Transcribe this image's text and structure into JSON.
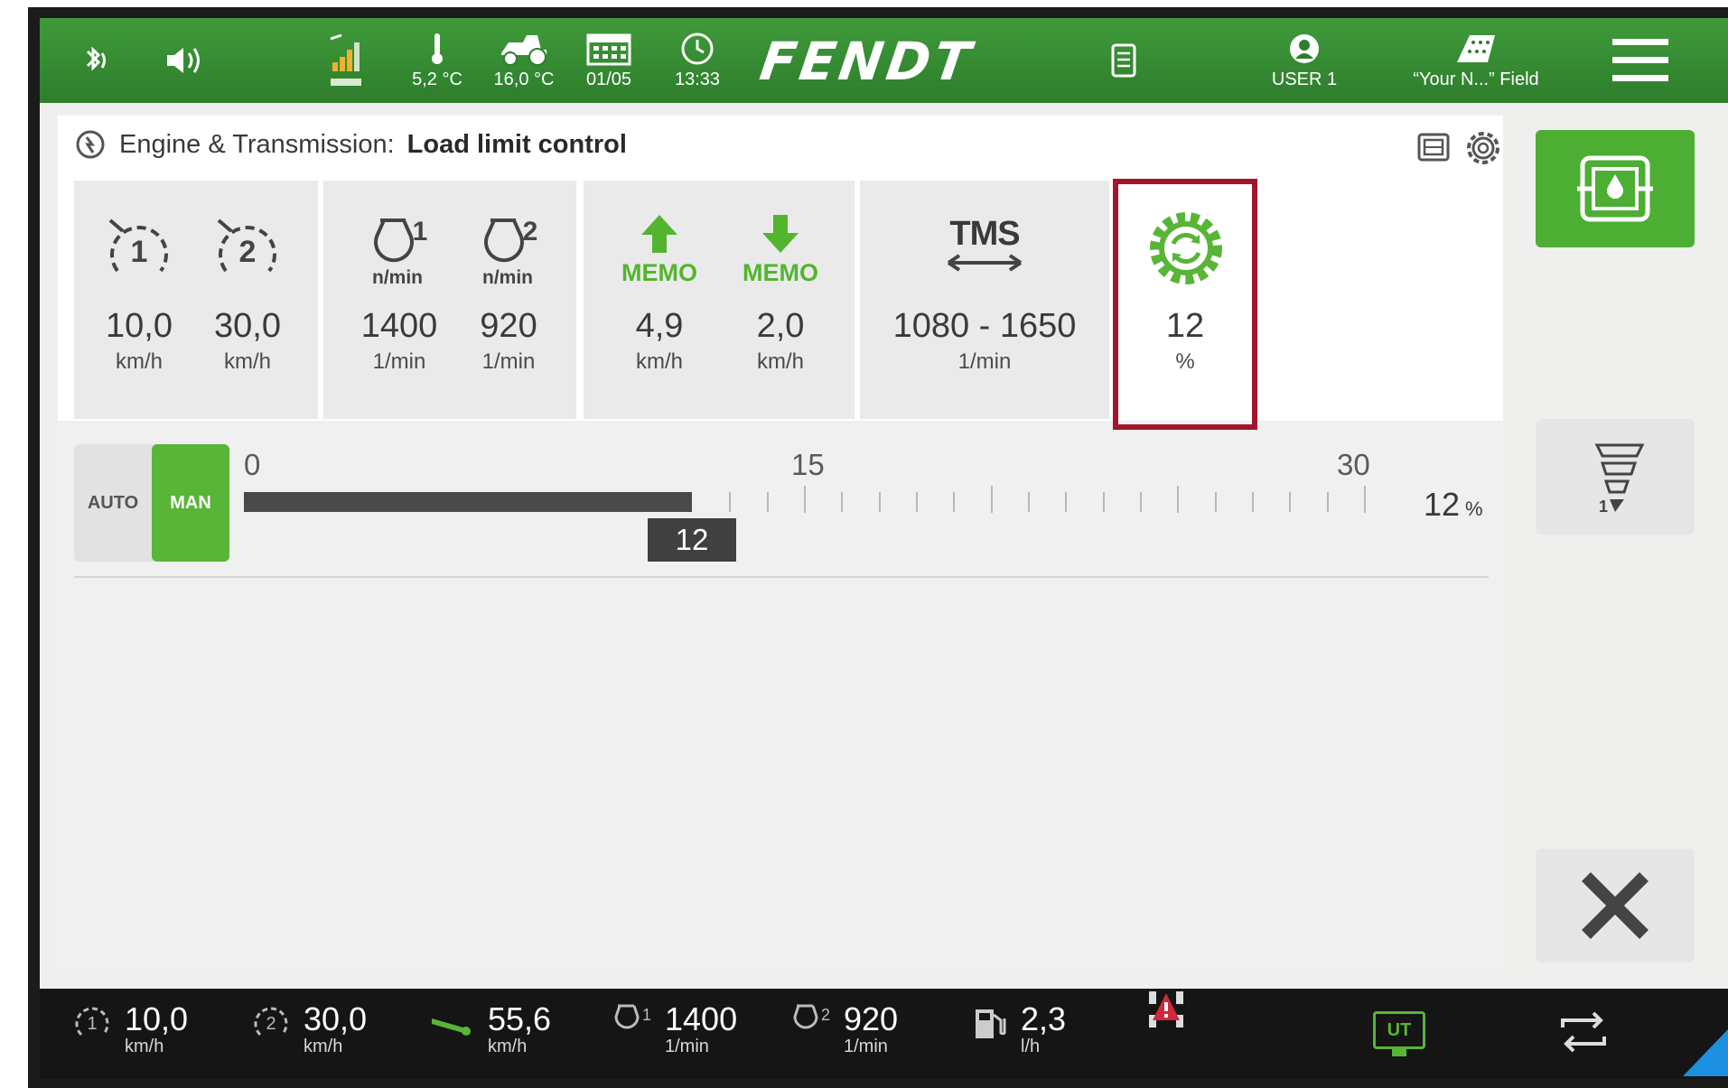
{
  "topbar": {
    "outside_temp": "5,2 °C",
    "engine_temp": "16,0 °C",
    "date": "01/05",
    "time": "13:33",
    "brand": "FENDT",
    "user": "USER 1",
    "field": "“Your N...” Field"
  },
  "header": {
    "prefix": "Engine & Transmission:",
    "title": "Load limit control"
  },
  "tiles": {
    "cruise1": {
      "value": "10,0",
      "unit": "km/h"
    },
    "cruise2": {
      "value": "30,0",
      "unit": "km/h"
    },
    "engine1": {
      "sub": "n/min",
      "value": "1400",
      "unit": "1/min",
      "index": "1"
    },
    "engine2": {
      "sub": "n/min",
      "value": "920",
      "unit": "1/min",
      "index": "2"
    },
    "memo_up": {
      "label": "MEMO",
      "value": "4,9",
      "unit": "km/h"
    },
    "memo_down": {
      "label": "MEMO",
      "value": "2,0",
      "unit": "km/h"
    },
    "tms": {
      "label": "TMS",
      "value": "1080 - 1650",
      "unit": "1/min"
    },
    "load_limit": {
      "value": "12",
      "unit": "%"
    }
  },
  "slider": {
    "auto_label": "AUTO",
    "man_label": "MAN",
    "scale_min": "0",
    "scale_mid": "15",
    "scale_max": "30",
    "value": "12",
    "value_fraction": 0.4,
    "readout": "12",
    "readout_unit": "%"
  },
  "bottombar": {
    "cruise1": {
      "value": "10,0",
      "unit": "km/h"
    },
    "cruise2": {
      "value": "30,0",
      "unit": "km/h"
    },
    "speed": {
      "value": "55,6",
      "unit": "km/h"
    },
    "engine1": {
      "value": "1400",
      "unit": "1/min"
    },
    "engine2": {
      "value": "920",
      "unit": "1/min"
    },
    "fuel": {
      "value": "2,3",
      "unit": "l/h"
    },
    "ut_label": "UT"
  },
  "colors": {
    "brand_green": "#3f9b3a",
    "accent_green": "#58b537",
    "highlight_red": "#a3152c"
  }
}
